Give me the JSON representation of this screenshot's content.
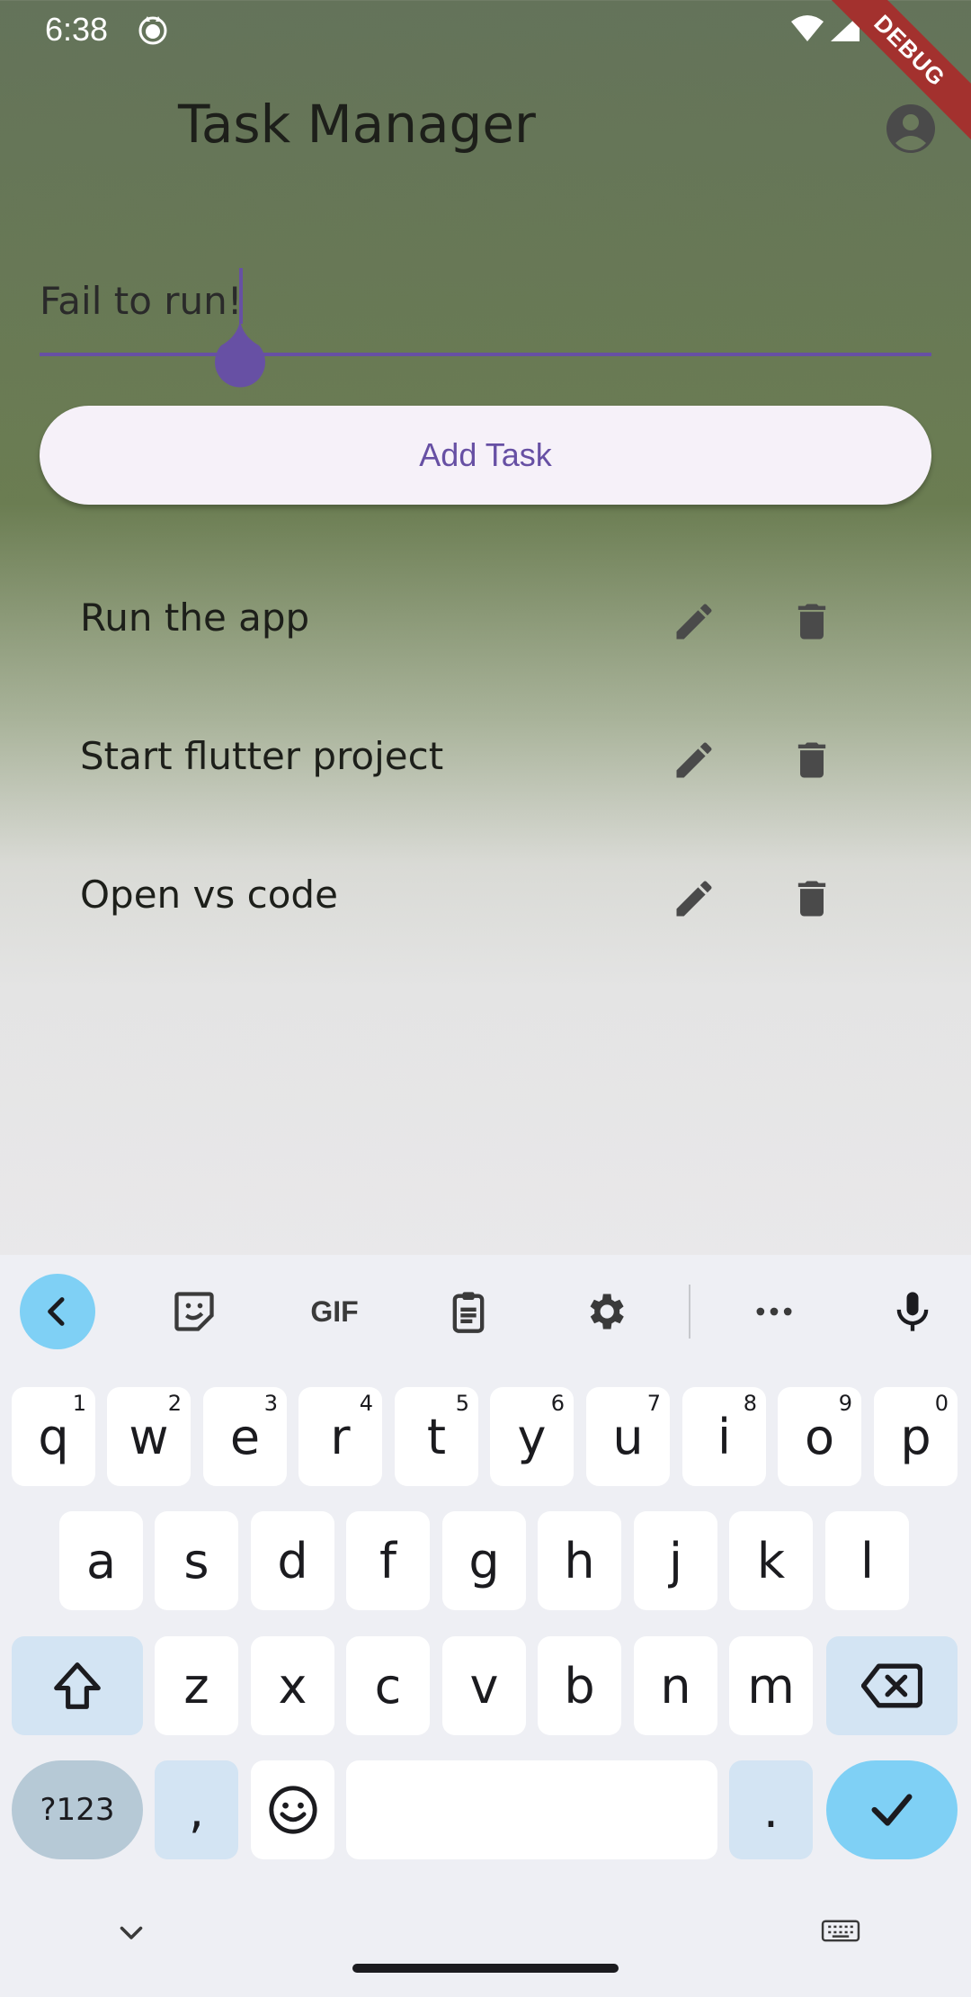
{
  "status_bar": {
    "time": "6:38"
  },
  "debug_banner": "DEBUG",
  "app_bar": {
    "title": "Task Manager"
  },
  "task_input": {
    "value": "Fail to run!"
  },
  "add_button": {
    "label": "Add Task"
  },
  "tasks": [
    {
      "label": "Run the app"
    },
    {
      "label": "Start flutter project"
    },
    {
      "label": "Open vs code"
    }
  ],
  "keyboard": {
    "row1": [
      {
        "key": "q",
        "sup": "1"
      },
      {
        "key": "w",
        "sup": "2"
      },
      {
        "key": "e",
        "sup": "3"
      },
      {
        "key": "r",
        "sup": "4"
      },
      {
        "key": "t",
        "sup": "5"
      },
      {
        "key": "y",
        "sup": "6"
      },
      {
        "key": "u",
        "sup": "7"
      },
      {
        "key": "i",
        "sup": "8"
      },
      {
        "key": "o",
        "sup": "9"
      },
      {
        "key": "p",
        "sup": "0"
      }
    ],
    "row2": [
      "a",
      "s",
      "d",
      "f",
      "g",
      "h",
      "j",
      "k",
      "l"
    ],
    "row3": [
      "z",
      "x",
      "c",
      "v",
      "b",
      "n",
      "m"
    ],
    "num_label": "?123",
    "comma": ",",
    "period": ".",
    "toolbar_gif": "GIF"
  },
  "colors": {
    "accent": "#6750a4",
    "keyboard_accent": "#7fd0f5",
    "debug_ribbon": "#a3312e"
  }
}
